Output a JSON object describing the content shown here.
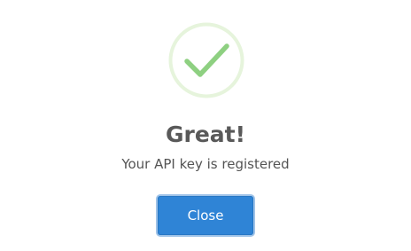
{
  "dialog": {
    "icon": "check-circle-icon",
    "title": "Great!",
    "message": "Your API key is registered",
    "close_label": "Close"
  },
  "colors": {
    "success_ring": "#e6f4dc",
    "success_check": "#8ed081",
    "button_bg": "#2f84d6",
    "button_border": "#9fc3e8",
    "title_text": "#595959"
  }
}
